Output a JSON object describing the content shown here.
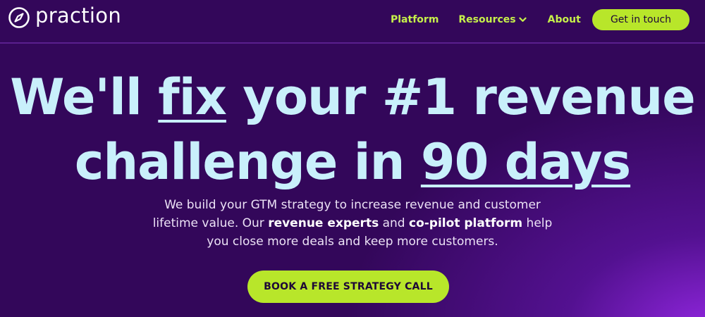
{
  "brand": {
    "name": "praction",
    "logo_icon": "compass-icon"
  },
  "nav": {
    "items": [
      {
        "label": "Platform"
      },
      {
        "label": "Resources",
        "icon": "chevron-down-icon"
      },
      {
        "label": "About"
      }
    ],
    "cta_label": "Get in touch"
  },
  "hero": {
    "title_parts": [
      "We'll ",
      "fix",
      " your #1 revenue",
      "challenge in ",
      "90 days"
    ],
    "subtitle_parts": [
      "We build your GTM strategy to increase revenue and customer lifetime value. Our ",
      "revenue experts",
      " and ",
      "co-pilot platform",
      " help you close more deals and keep more customers."
    ],
    "cta_label": "BOOK A FREE STRATEGY CALL"
  },
  "colors": {
    "background": "#33075a",
    "accent": "#b8e62a",
    "headline": "#c9f0fb",
    "nav_link": "#c6f04a"
  }
}
